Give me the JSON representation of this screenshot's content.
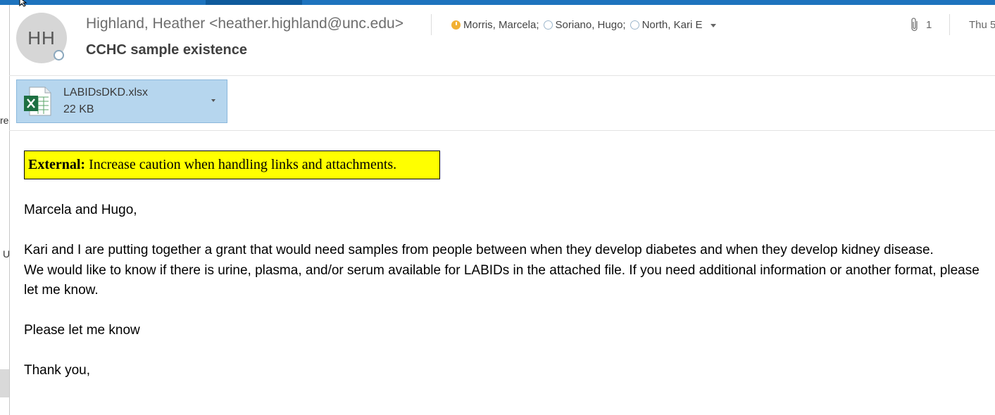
{
  "sender": {
    "initials": "HH",
    "display": "Highland, Heather <heather.highland@unc.edu>"
  },
  "subject": "CCHC sample existence",
  "recipients": [
    {
      "name": "Morris, Marcela;",
      "status": "away"
    },
    {
      "name": "Soriano, Hugo;",
      "status": "offline"
    },
    {
      "name": "North, Kari E",
      "status": "offline"
    }
  ],
  "attachment_count": "1",
  "date": "Thu 5",
  "attachment": {
    "file_name": "LABIDsDKD.xlsx",
    "file_size": "22 KB"
  },
  "banner": {
    "label": "External:",
    "text": "Increase caution when handling links and attachments."
  },
  "body": {
    "greeting": "Marcela and Hugo,",
    "para1": "Kari and I are putting together a grant that would need samples from people between when they develop diabetes and when they develop kidney disease.",
    "para2": "We would like to know if there is urine, plasma, and/or serum available for LABIDs in the attached file. If you need additional information or another format, please let me know.",
    "para3": "Please let me know",
    "closing": "Thank you,"
  },
  "left_edge": {
    "fragment1": "re",
    "fragment2": "U"
  },
  "colors": {
    "banner_bg": "#ffff00",
    "attachment_bg": "#b6d6ee",
    "away_status": "#f2b134",
    "title_bar": "#1e73be"
  },
  "icons": [
    "cursor-icon",
    "presence-icon",
    "away-status-icon",
    "offline-status-icon",
    "dropdown-icon",
    "paperclip-icon",
    "excel-file-icon"
  ]
}
